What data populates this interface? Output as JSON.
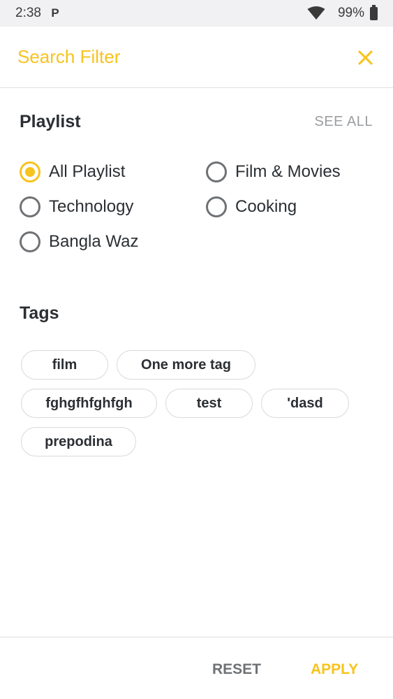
{
  "status_bar": {
    "time": "2:38",
    "app_glyph": "P",
    "battery": "99%"
  },
  "header": {
    "title": "Search Filter"
  },
  "playlist": {
    "title": "Playlist",
    "see_all": "SEE ALL",
    "options": [
      {
        "label": "All Playlist",
        "selected": true
      },
      {
        "label": "Film & Movies",
        "selected": false
      },
      {
        "label": "Technology",
        "selected": false
      },
      {
        "label": "Cooking",
        "selected": false
      },
      {
        "label": "Bangla Waz",
        "selected": false
      }
    ]
  },
  "tags": {
    "title": "Tags",
    "items": [
      "film",
      "One more tag",
      "fghgfhfghfgh",
      "test",
      "'dasd",
      "prepodina"
    ]
  },
  "footer": {
    "reset": "RESET",
    "apply": "APPLY"
  },
  "colors": {
    "accent": "#f7c31d",
    "text": "#2b2f33",
    "muted": "#9a9da0"
  }
}
